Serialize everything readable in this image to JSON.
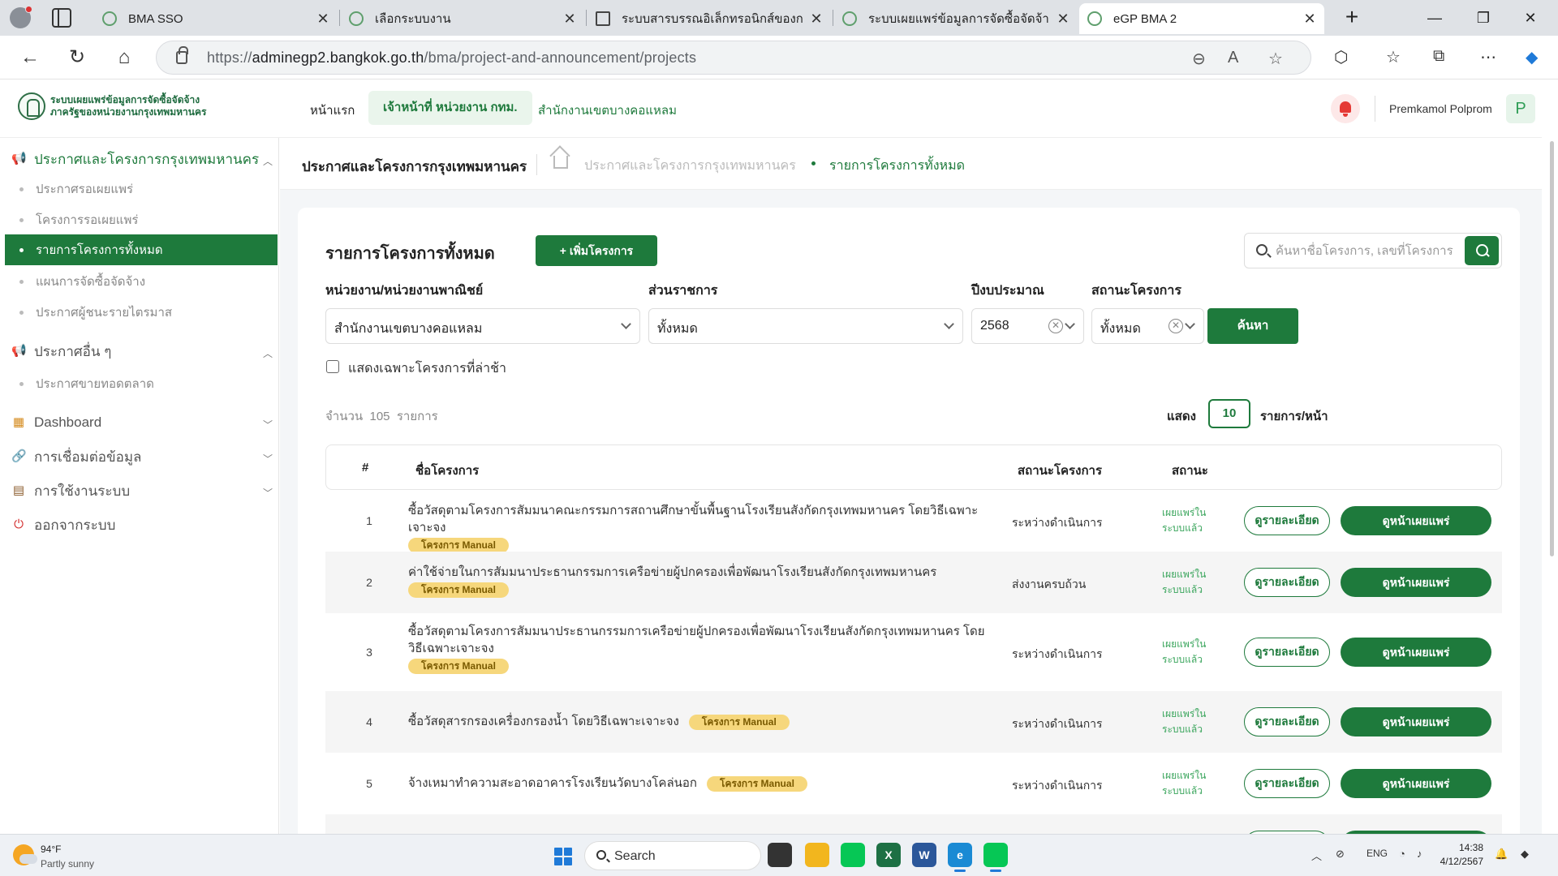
{
  "browser": {
    "tabs": [
      {
        "title": "BMA SSO",
        "active": false
      },
      {
        "title": "เลือกระบบงาน",
        "active": false
      },
      {
        "title": "ระบบสารบรรณอิเล็กทรอนิกส์ของกรุงเ",
        "active": false
      },
      {
        "title": "ระบบเผยแพร่ข้อมูลการจัดซื้อจัดจ้างภ",
        "active": false
      },
      {
        "title": "eGP BMA 2",
        "active": true
      }
    ],
    "url_prefix": "https://",
    "url_host": "adminegp2.bangkok.go.th",
    "url_path": "/bma/project-and-announcement/projects"
  },
  "header": {
    "brand_line1": "ระบบเผยแพร่ข้อมูลการจัดซื้อจัดจ้าง",
    "brand_line2": "ภาครัฐของหน่วยงานกรุงเทพมหานคร",
    "nav_home": "หน้าแรก",
    "nav_role": "เจ้าหน้าที่ หน่วยงาน กทม.",
    "nav_office": "สำนักงานเขตบางคอแหลม",
    "user_name": "Premkamol Polprom",
    "avatar_initial": "P"
  },
  "sidebar": {
    "sections": [
      {
        "label": "ประกาศและโครงการกรุงเทพมหานคร",
        "open": true,
        "items": [
          "ประกาศรอเผยแพร่",
          "โครงการรอเผยแพร่",
          "รายการโครงการทั้งหมด",
          "แผนการจัดซื้อจัดจ้าง",
          "ประกาศผู้ชนะรายไตรมาส"
        ]
      },
      {
        "label": "ประกาศอื่น ๆ",
        "open": true,
        "items": [
          "ประกาศขายทอดตลาด"
        ]
      },
      {
        "label": "Dashboard",
        "open": false,
        "items": []
      },
      {
        "label": "การเชื่อมต่อข้อมูล",
        "open": false,
        "items": []
      },
      {
        "label": "การใช้งานระบบ",
        "open": false,
        "items": []
      },
      {
        "label": "ออกจากระบบ",
        "open": false,
        "items": []
      }
    ]
  },
  "page": {
    "title": "ประกาศและโครงการกรุงเทพมหานคร",
    "breadcrumb_parent": "ประกาศและโครงการกรุงเทพมหานคร",
    "breadcrumb_current": "รายการโครงการทั้งหมด"
  },
  "card": {
    "title": "รายการโครงการทั้งหมด",
    "add_label": "+ เพิ่มโครงการ",
    "search_placeholder": "ค้นหาชื่อโครงการ, เลขที่โครงการ"
  },
  "filters": {
    "agency_label": "หน่วยงาน/หน่วยงานพาณิชย์",
    "agency_value": "สำนักงานเขตบางคอแหลม",
    "division_label": "ส่วนราชการ",
    "division_value": "ทั้งหมด",
    "year_label": "ปีงบประมาณ",
    "year_value": "2568",
    "status_label": "สถานะโครงการ",
    "status_value": "ทั้งหมด",
    "search_btn": "ค้นหา",
    "late_only_label": "แสดงเฉพาะโครงการที่ล่าช้า"
  },
  "listing": {
    "count_prefix": "จำนวน",
    "count": "105",
    "count_suffix": "รายการ",
    "show_label": "แสดง",
    "page_size": "10",
    "per_page_label": "รายการ/หน้า"
  },
  "table": {
    "headers": {
      "num": "#",
      "name": "ชื่อโครงการ",
      "project_status": "สถานะโครงการ",
      "status": "สถานะ"
    },
    "badge": "โครงการ Manual",
    "detail_btn": "ดูรายละเอียด",
    "publish_btn": "ดูหน้าเผยแพร่",
    "rows": [
      {
        "num": "1",
        "name": "ซื้อวัสดุตามโครงการสัมมนาคณะกรรมการสถานศึกษาขั้นพื้นฐานโรงเรียนสังกัดกรุงเทพมหานคร โดยวิธีเฉพาะเจาะจง",
        "project_status": "ระหว่างดำเนินการ",
        "pub_line1": "เผยแพร่ใน",
        "pub_line2": "ระบบแล้ว"
      },
      {
        "num": "2",
        "name": "ค่าใช้จ่ายในการสัมมนาประธานกรรมการเครือข่ายผู้ปกครองเพื่อพัฒนาโรงเรียนสังกัดกรุงเทพมหานคร",
        "project_status": "ส่งงานครบถ้วน",
        "pub_line1": "เผยแพร่ใน",
        "pub_line2": "ระบบแล้ว"
      },
      {
        "num": "3",
        "name": "ซื้อวัสดุตามโครงการสัมมนาประธานกรรมการเครือข่ายผู้ปกครองเพื่อพัฒนาโรงเรียนสังกัดกรุงเทพมหานคร โดยวิธีเฉพาะเจาะจง",
        "project_status": "ระหว่างดำเนินการ",
        "pub_line1": "เผยแพร่ใน",
        "pub_line2": "ระบบแล้ว"
      },
      {
        "num": "4",
        "name": "ซื้อวัสดุสารกรองเครื่องกรองน้ำ โดยวิธีเฉพาะเจาะจง",
        "project_status": "ระหว่างดำเนินการ",
        "pub_line1": "เผยแพร่ใน",
        "pub_line2": "ระบบแล้ว"
      },
      {
        "num": "5",
        "name": "จ้างเหมาทำความสะอาดอาคารโรงเรียนวัดบางโคล่นอก",
        "project_status": "ระหว่างดำเนินการ",
        "pub_line1": "เผยแพร่ใน",
        "pub_line2": "ระบบแล้ว"
      }
    ]
  },
  "taskbar": {
    "temp": "94°F",
    "weather": "Partly sunny",
    "search": "Search",
    "lang": "ENG",
    "time": "14:38",
    "date": "4/12/2567"
  }
}
